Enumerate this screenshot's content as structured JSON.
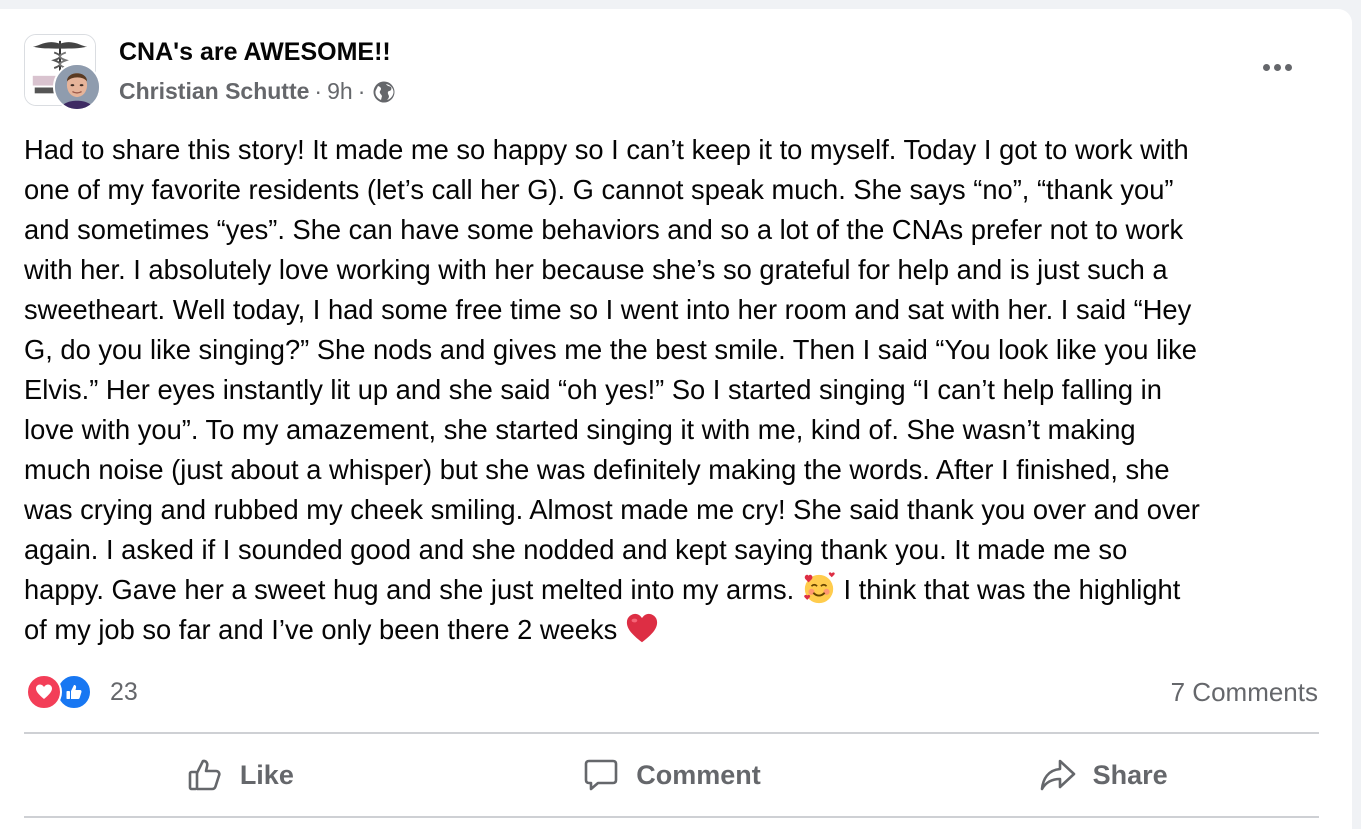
{
  "post": {
    "group_name": "CNA's are AWESOME!!",
    "author": "Christian Schutte",
    "time": "9h",
    "separator": "·",
    "privacy_icon": "globe-icon",
    "more_icon": "more-options-icon",
    "body_lines": [
      "Had to share this story! It made me so happy so I can’t keep it to myself. Today I got to work with",
      "one of my favorite residents (let’s call her G). G cannot speak much. She says “no”, “thank you”",
      "and sometimes “yes”. She can have some behaviors and so a lot of the CNAs prefer not to work",
      "with her. I absolutely love working with her because she’s so grateful for help and is just such a",
      "sweetheart. Well today, I had some free time so I went into her room and sat with her. I said “Hey",
      "G, do you like singing?” She nods and gives me the best smile. Then I said “You look like you like",
      "Elvis.” Her eyes instantly lit up and she said “oh yes!” So I started singing “I can’t help falling in",
      "love with you”. To my amazement, she started singing it with me, kind of. She wasn’t making",
      "much noise (just about a whisper) but she was definitely making the words. After I finished, she",
      "was crying and rubbed my cheek smiling. Almost made me cry! She said thank you over and over",
      "again. I asked if I sounded good and she nodded and kept saying thank you. It made me so"
    ],
    "line_12_before": "happy. Gave her a sweet hug and she just melted into my arms. ",
    "line_12_after": " I think that was the highlight",
    "line_13": "of my job so far and I’ve only been there 2 weeks ",
    "emoji_1": "smiling-face-with-hearts",
    "emoji_2": "red-heart"
  },
  "reactions": {
    "types": [
      "love",
      "like"
    ],
    "count": "23",
    "comments": "7 Comments"
  },
  "actions": {
    "like": "Like",
    "comment": "Comment",
    "share": "Share"
  },
  "colors": {
    "love": "#f33e58",
    "like": "#1877f2",
    "secondary_text": "#65676b",
    "primary_text": "#050505"
  }
}
